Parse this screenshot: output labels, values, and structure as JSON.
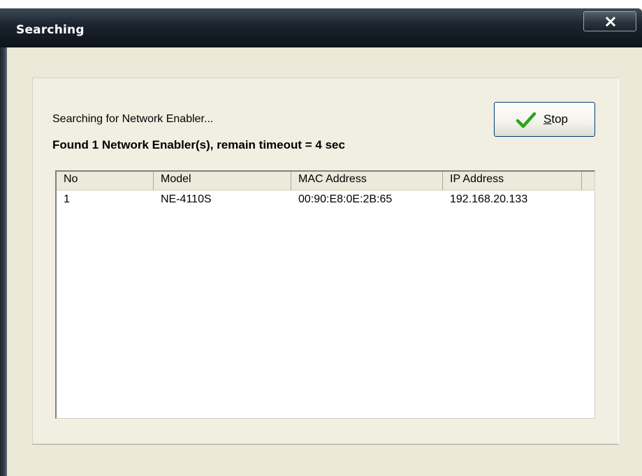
{
  "window": {
    "title": "Searching",
    "close_icon": "close-x-icon"
  },
  "dialog": {
    "status_text": "Searching for Network Enabler...",
    "found_text": "Found 1 Network Enabler(s), remain timeout = 4 sec",
    "stop_button": {
      "mnemonic": "S",
      "label_rest": "top",
      "icon": "checkmark-icon"
    }
  },
  "table": {
    "columns": [
      "No",
      "Model",
      "MAC Address",
      "IP Address"
    ],
    "rows": [
      [
        "1",
        "NE-4110S",
        "00:90:E8:0E:2B:65",
        "192.168.20.133"
      ]
    ]
  },
  "colors": {
    "titlebar": "#1c2530",
    "dialog_face": "#ece9d8",
    "check_green": "#2fa31f"
  }
}
